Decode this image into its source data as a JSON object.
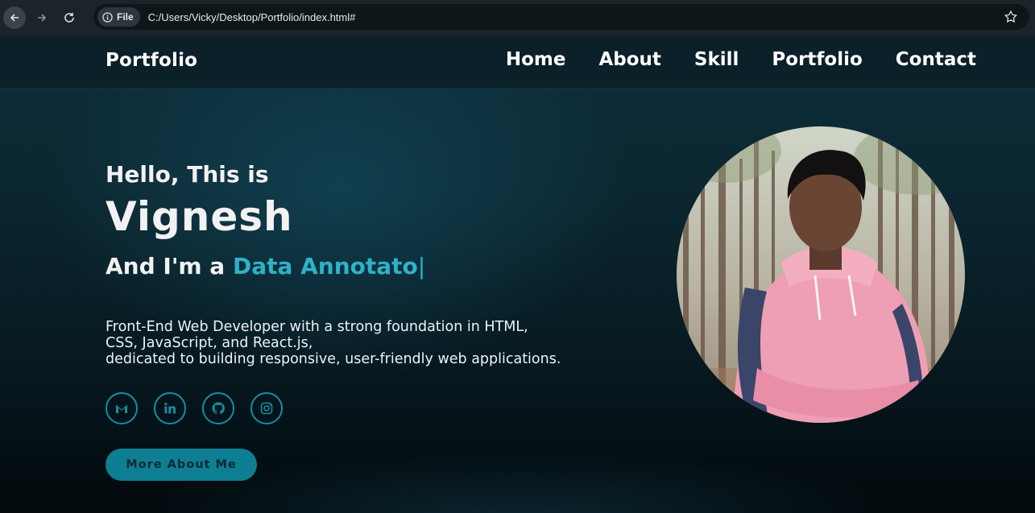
{
  "browser": {
    "file_label": "File",
    "url": "C:/Users/Vicky/Desktop/Portfolio/index.html#"
  },
  "header": {
    "logo": "Portfolio",
    "nav": [
      "Home",
      "About",
      "Skill",
      "Portfolio",
      "Contact"
    ]
  },
  "hero": {
    "greeting": "Hello, This is",
    "name": "Vignesh",
    "role_prefix": "And I'm a ",
    "role_typed": "Data Annotato",
    "caret": "|",
    "description_lines": [
      "Front-End Web Developer with a strong foundation in HTML,",
      "CSS, JavaScript, and React.js,",
      "dedicated to building responsive, user-friendly web applications."
    ],
    "socials": [
      "gmail-icon",
      "linkedin-icon",
      "github-icon",
      "instagram-icon"
    ],
    "cta_label": "More About Me"
  },
  "colors": {
    "accent": "#2fb2c7",
    "button": "#0e7f93",
    "icon_ring": "#178ea3"
  }
}
